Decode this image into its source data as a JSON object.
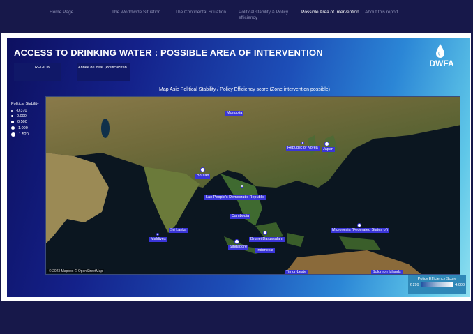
{
  "nav": {
    "items": [
      {
        "label": "Home Page"
      },
      {
        "label": "The Worldwide Situation"
      },
      {
        "label": "The Continental Situation"
      },
      {
        "label": "Political stability & Policy efficiency"
      },
      {
        "label": "Possible Area of Intervention"
      },
      {
        "label": "About this report"
      }
    ],
    "active_index": 4
  },
  "page": {
    "title": "ACCESS TO DRINKING WATER : POSSIBLE AREA OF INTERVENTION",
    "logo_text": "DWFA"
  },
  "filters": {
    "region_label": "REGION",
    "year_label": "Année de Year (PoliticalStab.."
  },
  "stability_legend": {
    "title": "Political Stability",
    "values": [
      "-0.370",
      "0.000",
      "0.500",
      "1.000",
      "1.520"
    ]
  },
  "map": {
    "title": "Map Asie Political Stability / Policy Efficiency score (Zone intervention possible)",
    "attribution": "© 2023 Mapbox © OpenStreetMap",
    "countries": [
      {
        "name": "Mongolia"
      },
      {
        "name": "Republic of Korea"
      },
      {
        "name": "Japan"
      },
      {
        "name": "Bhutan"
      },
      {
        "name": "Lao People's Democratic Republic"
      },
      {
        "name": "Cambodia"
      },
      {
        "name": "Sri Lanka"
      },
      {
        "name": "Maldives"
      },
      {
        "name": "Brunei Darussalam"
      },
      {
        "name": "Singapore"
      },
      {
        "name": "Indonesia"
      },
      {
        "name": "Micronesia (Federated States of)"
      },
      {
        "name": "Timor-Leste"
      },
      {
        "name": "Solomon Islands"
      }
    ]
  },
  "efficiency_legend": {
    "title": "Policy Efficiency Score",
    "min": "2.299",
    "max": "4.000"
  },
  "colors": {
    "nav_bg": "#17184a",
    "label_bg": "#3a35d8",
    "accent_light": "#8fe0f0"
  }
}
